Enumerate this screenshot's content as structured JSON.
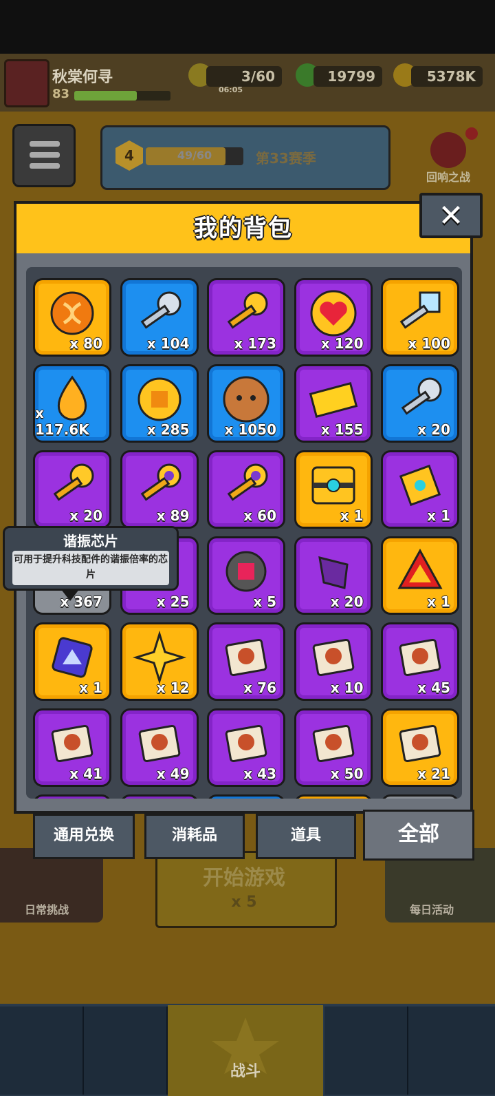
{
  "player": {
    "name": "秋棠何寻",
    "level": "83",
    "xp_fraction": 0.65
  },
  "resources": {
    "energy": "3/60",
    "energy_timer": "06:05",
    "gems": "19799",
    "coins": "5378K"
  },
  "season": {
    "level": "4",
    "progress": "49/60",
    "progress_fraction": 0.8167,
    "name": "第33赛季"
  },
  "right_event_label": "回响之战",
  "bottom": {
    "left_label": "日常挑战",
    "right_label": "每日活动",
    "start_text": "开始游戏",
    "start_cost": "x 5",
    "nav_center_label": "战斗"
  },
  "modal": {
    "title": "我的背包",
    "close_label": "✕"
  },
  "items": [
    {
      "name": "dna-orb",
      "rarity": "orange",
      "qty": "x 80",
      "icon": "dna-orb-icon"
    },
    {
      "name": "silver-key",
      "rarity": "blue",
      "qty": "x 104",
      "icon": "silver-key-icon"
    },
    {
      "name": "gold-key",
      "rarity": "purple",
      "qty": "x 173",
      "icon": "gold-key-icon"
    },
    {
      "name": "heart-medal",
      "rarity": "purple",
      "qty": "x 120",
      "icon": "heart-medal-icon"
    },
    {
      "name": "crystal-key",
      "rarity": "orange",
      "qty": "x 100",
      "icon": "crystal-key-icon"
    },
    {
      "name": "fire-drop",
      "rarity": "blue",
      "qty": "x 117.6K",
      "icon": "drop-icon"
    },
    {
      "name": "gold-coin",
      "rarity": "blue",
      "qty": "x 285",
      "icon": "coin-icon"
    },
    {
      "name": "pet-cookie",
      "rarity": "blue",
      "qty": "x 1050",
      "icon": "cookie-icon"
    },
    {
      "name": "gold-ticket",
      "rarity": "purple",
      "qty": "x 155",
      "icon": "ticket-icon"
    },
    {
      "name": "gear-key",
      "rarity": "blue",
      "qty": "x 20",
      "icon": "gear-key-icon"
    },
    {
      "name": "smile-key",
      "rarity": "purple",
      "qty": "x 20",
      "icon": "smile-key-icon"
    },
    {
      "name": "gem-key",
      "rarity": "purple",
      "qty": "x 89",
      "icon": "gem-key-icon"
    },
    {
      "name": "hex-key",
      "rarity": "purple",
      "qty": "x 60",
      "icon": "hex-key-icon"
    },
    {
      "name": "treasure-chest",
      "rarity": "orange",
      "qty": "x 1",
      "icon": "chest-icon"
    },
    {
      "name": "gem-tablet",
      "rarity": "purple",
      "qty": "x 1",
      "icon": "tablet-icon"
    },
    {
      "name": "resonance-chip",
      "rarity": "gray",
      "qty": "x 367",
      "icon": "chip-icon"
    },
    {
      "name": "purple-item",
      "rarity": "purple",
      "qty": "x 25",
      "icon": "orb-icon"
    },
    {
      "name": "ruby-sphere",
      "rarity": "purple",
      "qty": "x 5",
      "icon": "ruby-icon"
    },
    {
      "name": "crystal-shard",
      "rarity": "purple",
      "qty": "x 20",
      "icon": "shard-icon"
    },
    {
      "name": "red-triangle",
      "rarity": "orange",
      "qty": "x 1",
      "icon": "triangle-icon"
    },
    {
      "name": "cube-chip",
      "rarity": "orange",
      "qty": "x 1",
      "icon": "cube-icon"
    },
    {
      "name": "gold-star",
      "rarity": "orange",
      "qty": "x 12",
      "icon": "star-icon"
    },
    {
      "name": "puzzle-1",
      "rarity": "purple",
      "qty": "x 76",
      "icon": "puzzle-icon"
    },
    {
      "name": "puzzle-2",
      "rarity": "purple",
      "qty": "x 10",
      "icon": "puzzle-icon"
    },
    {
      "name": "puzzle-3",
      "rarity": "purple",
      "qty": "x 45",
      "icon": "puzzle-icon"
    },
    {
      "name": "puzzle-4",
      "rarity": "purple",
      "qty": "x 41",
      "icon": "puzzle-icon"
    },
    {
      "name": "puzzle-5",
      "rarity": "purple",
      "qty": "x 49",
      "icon": "puzzle-icon"
    },
    {
      "name": "puzzle-6",
      "rarity": "purple",
      "qty": "x 43",
      "icon": "puzzle-icon"
    },
    {
      "name": "puzzle-7",
      "rarity": "purple",
      "qty": "x 50",
      "icon": "puzzle-icon"
    },
    {
      "name": "puzzle-8",
      "rarity": "orange",
      "qty": "x 21",
      "icon": "puzzle-icon"
    }
  ],
  "tabs": [
    {
      "label": "通用兑换",
      "active": false
    },
    {
      "label": "消耗品",
      "active": false
    },
    {
      "label": "道具",
      "active": false
    },
    {
      "label": "全部",
      "active": true
    }
  ],
  "tooltip": {
    "title": "谐振芯片",
    "description": "可用于提升科技配件的谐振倍率的芯片"
  },
  "colors": {
    "rarity_orange": "#ffb70f",
    "rarity_blue": "#1d8ff0",
    "rarity_purple": "#9b32e0",
    "header_yellow": "#ffc21a"
  }
}
